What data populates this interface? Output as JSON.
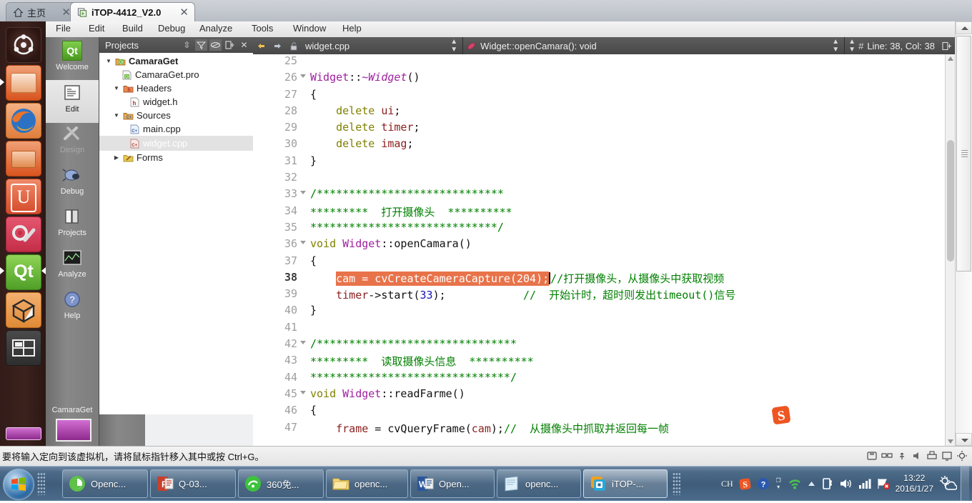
{
  "browser": {
    "tabs": [
      {
        "label": "主页",
        "icon": "home-icon",
        "active": false,
        "close": "✕"
      },
      {
        "label": "iTOP-4412_V2.0",
        "icon": "vm-icon",
        "active": true,
        "close": "✕"
      }
    ]
  },
  "launcher": {
    "items": [
      {
        "name": "ubuntu-dash",
        "color": "#2c1a16"
      },
      {
        "name": "files-folder",
        "color": "#e8713a"
      },
      {
        "name": "firefox",
        "color": "#e8a45a"
      },
      {
        "name": "software-center",
        "color": "#e07a45"
      },
      {
        "name": "ubuntu-one",
        "color": "#dd5b3f"
      },
      {
        "name": "system-settings",
        "color": "#d1445a"
      },
      {
        "name": "qt-creator",
        "color": "#60b43c"
      },
      {
        "name": "virtualbox",
        "color": "#e89a4a"
      },
      {
        "name": "workspace-switcher",
        "color": "#3a2a26"
      }
    ]
  },
  "menubar": {
    "items": [
      "File",
      "Edit",
      "Build",
      "Debug",
      "Analyze",
      "Tools",
      "Window",
      "Help"
    ]
  },
  "modebar": {
    "modes": [
      {
        "label": "Welcome",
        "icon": "qt-logo-icon",
        "state": "normal"
      },
      {
        "label": "Edit",
        "icon": "document-icon",
        "state": "selected"
      },
      {
        "label": "Design",
        "icon": "design-tools-icon",
        "state": "disabled"
      },
      {
        "label": "Debug",
        "icon": "bug-icon",
        "state": "normal"
      },
      {
        "label": "Projects",
        "icon": "books-icon",
        "state": "normal"
      },
      {
        "label": "Analyze",
        "icon": "chart-icon",
        "state": "normal"
      },
      {
        "label": "Help",
        "icon": "question-mark-icon",
        "state": "normal"
      }
    ],
    "kit_label": "CamaraGet"
  },
  "projects_panel": {
    "title": "Projects",
    "toolbar_icons": [
      "sort-icon",
      "filter-icon",
      "link-icon",
      "split-icon",
      "close-icon"
    ],
    "tree": [
      {
        "label": "CamaraGet",
        "depth": 0,
        "arrow": "▼",
        "icon": "qt-project-icon",
        "bold": true,
        "selected": false
      },
      {
        "label": "CamaraGet.pro",
        "depth": 1,
        "arrow": "",
        "icon": "pro-file-icon",
        "bold": false,
        "selected": false
      },
      {
        "label": "Headers",
        "depth": 1,
        "arrow": "▼",
        "icon": "folder-h-icon",
        "bold": false,
        "selected": false
      },
      {
        "label": "widget.h",
        "depth": 2,
        "arrow": "",
        "icon": "h-file-icon",
        "bold": false,
        "selected": false
      },
      {
        "label": "Sources",
        "depth": 1,
        "arrow": "▼",
        "icon": "folder-cpp-icon",
        "bold": false,
        "selected": false
      },
      {
        "label": "main.cpp",
        "depth": 2,
        "arrow": "",
        "icon": "cpp-file-icon",
        "bold": false,
        "selected": false
      },
      {
        "label": "widget.cpp",
        "depth": 2,
        "arrow": "",
        "icon": "cpp-file-icon",
        "bold": false,
        "selected": true
      },
      {
        "label": "Forms",
        "depth": 1,
        "arrow": "▶",
        "icon": "folder-ui-icon",
        "bold": false,
        "selected": false
      }
    ]
  },
  "editor_bar": {
    "back_icon": "arrow-back-icon",
    "forward_icon": "arrow-forward-icon",
    "lock_icon": "unlocked-icon",
    "filename": "widget.cpp",
    "symbol_icon": "symbol-icon",
    "symbol": "Widget::openCamara(): void",
    "line_col_icon": "#",
    "line_col": "Line: 38, Col: 38",
    "split_icon": "split-editor-icon"
  },
  "code": {
    "selection_color": "#e8734a",
    "selection_text_color": "#ffffff",
    "current_line": 38,
    "lines": [
      {
        "n": 25,
        "fold": false,
        "tokens": []
      },
      {
        "n": 26,
        "fold": true,
        "tokens": [
          {
            "t": "Widget",
            "c": "cls"
          },
          {
            "t": "::",
            "c": "plain"
          },
          {
            "t": "~Widget",
            "c": "cls it"
          },
          {
            "t": "()",
            "c": "plain"
          }
        ]
      },
      {
        "n": 27,
        "fold": false,
        "tokens": [
          {
            "t": "{",
            "c": "plain"
          }
        ]
      },
      {
        "n": 28,
        "fold": false,
        "tokens": [
          {
            "t": "    ",
            "c": "plain"
          },
          {
            "t": "delete",
            "c": "kw"
          },
          {
            "t": " ",
            "c": "plain"
          },
          {
            "t": "ui",
            "c": "id"
          },
          {
            "t": ";",
            "c": "plain"
          }
        ]
      },
      {
        "n": 29,
        "fold": false,
        "tokens": [
          {
            "t": "    ",
            "c": "plain"
          },
          {
            "t": "delete",
            "c": "kw"
          },
          {
            "t": " ",
            "c": "plain"
          },
          {
            "t": "timer",
            "c": "id"
          },
          {
            "t": ";",
            "c": "plain"
          }
        ]
      },
      {
        "n": 30,
        "fold": false,
        "tokens": [
          {
            "t": "    ",
            "c": "plain"
          },
          {
            "t": "delete",
            "c": "kw"
          },
          {
            "t": " ",
            "c": "plain"
          },
          {
            "t": "imag",
            "c": "id"
          },
          {
            "t": ";",
            "c": "plain"
          }
        ]
      },
      {
        "n": 31,
        "fold": false,
        "tokens": [
          {
            "t": "}",
            "c": "plain"
          }
        ]
      },
      {
        "n": 32,
        "fold": false,
        "tokens": []
      },
      {
        "n": 33,
        "fold": true,
        "tokens": [
          {
            "t": "/*****************************",
            "c": "cmt"
          }
        ]
      },
      {
        "n": 34,
        "fold": false,
        "tokens": [
          {
            "t": "*********  打开摄像头  **********",
            "c": "cmt"
          }
        ]
      },
      {
        "n": 35,
        "fold": false,
        "tokens": [
          {
            "t": "*****************************/",
            "c": "cmt"
          }
        ]
      },
      {
        "n": 36,
        "fold": true,
        "tokens": [
          {
            "t": "void",
            "c": "kw"
          },
          {
            "t": " ",
            "c": "plain"
          },
          {
            "t": "Widget",
            "c": "cls"
          },
          {
            "t": "::openCamara()",
            "c": "plain"
          }
        ]
      },
      {
        "n": 37,
        "fold": false,
        "tokens": [
          {
            "t": "{",
            "c": "plain"
          }
        ]
      },
      {
        "n": 38,
        "fold": false,
        "current": true,
        "tokens": [
          {
            "t": "    ",
            "c": "plain"
          },
          {
            "t": "cam = cvCreateCameraCapture(204);",
            "c": "sel"
          },
          {
            "t": "caret",
            "c": "caret"
          },
          {
            "t": "//打开摄像头，从摄像头中获取视频",
            "c": "cmt"
          }
        ]
      },
      {
        "n": 39,
        "fold": false,
        "tokens": [
          {
            "t": "    ",
            "c": "plain"
          },
          {
            "t": "timer",
            "c": "id"
          },
          {
            "t": "->start(",
            "c": "plain"
          },
          {
            "t": "33",
            "c": "num"
          },
          {
            "t": ");",
            "c": "plain"
          },
          {
            "t": "            ",
            "c": "plain"
          },
          {
            "t": "//  开始计时，超时则发出timeout()信号",
            "c": "cmt"
          }
        ]
      },
      {
        "n": 40,
        "fold": false,
        "tokens": [
          {
            "t": "}",
            "c": "plain"
          }
        ]
      },
      {
        "n": 41,
        "fold": false,
        "tokens": []
      },
      {
        "n": 42,
        "fold": true,
        "tokens": [
          {
            "t": "/*******************************",
            "c": "cmt"
          }
        ]
      },
      {
        "n": 43,
        "fold": false,
        "tokens": [
          {
            "t": "*********  读取摄像头信息  **********",
            "c": "cmt"
          }
        ]
      },
      {
        "n": 44,
        "fold": false,
        "tokens": [
          {
            "t": "*******************************/",
            "c": "cmt"
          }
        ]
      },
      {
        "n": 45,
        "fold": true,
        "tokens": [
          {
            "t": "void",
            "c": "kw"
          },
          {
            "t": " ",
            "c": "plain"
          },
          {
            "t": "Widget",
            "c": "cls"
          },
          {
            "t": "::readFarme()",
            "c": "plain"
          }
        ]
      },
      {
        "n": 46,
        "fold": false,
        "tokens": [
          {
            "t": "{",
            "c": "plain"
          }
        ]
      },
      {
        "n": 47,
        "fold": false,
        "tokens": [
          {
            "t": "    ",
            "c": "plain"
          },
          {
            "t": "frame",
            "c": "id"
          },
          {
            "t": " = cvQueryFrame(",
            "c": "plain"
          },
          {
            "t": "cam",
            "c": "id"
          },
          {
            "t": ");",
            "c": "plain"
          },
          {
            "t": "//  从摄像头中抓取并返回每一帧",
            "c": "cmt"
          }
        ]
      }
    ]
  },
  "ime": {
    "floating_logo": "sogou-icon"
  },
  "vmware_status": {
    "message": "要将输入定向到该虚拟机，请将鼠标指针移入其中或按 Ctrl+G。",
    "tray_icons": [
      "disk-icon",
      "network-icon",
      "usb-icon",
      "sound-icon",
      "printer-icon",
      "display-icon",
      "settings-icon"
    ]
  },
  "taskbar": {
    "start_icon": "windows-start-icon",
    "buttons": [
      {
        "label": "Openc...",
        "icon": "ie-icon",
        "active": false
      },
      {
        "label": "Q-03...",
        "icon": "powerpoint-icon",
        "active": false
      },
      {
        "label": "360免...",
        "icon": "360-wifi-icon",
        "active": false
      },
      {
        "label": "openc...",
        "icon": "folder-icon",
        "active": false
      },
      {
        "label": "Open...",
        "icon": "word-icon",
        "active": false
      },
      {
        "label": "openc...",
        "icon": "notepad-icon",
        "active": false
      },
      {
        "label": "iTOP-...",
        "icon": "vmware-icon",
        "active": true
      }
    ],
    "tray": {
      "input_language": "CH",
      "icons": [
        "sogou-icon",
        "help-icon",
        "expand-icon",
        "wifi-icon",
        "show-hidden-icon",
        "battery-icon",
        "volume-icon",
        "signal-icon",
        "action-center-icon"
      ],
      "time": "13:22",
      "date": "2016/1/27",
      "weather_icon": "weather-sun-cloud-icon"
    }
  }
}
